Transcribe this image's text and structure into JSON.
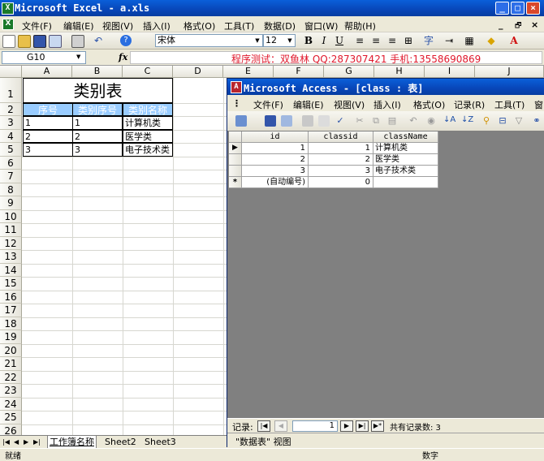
{
  "excel": {
    "title": "Microsoft Excel - a.xls",
    "menu": [
      "文件(F)",
      "编辑(E)",
      "视图(V)",
      "插入(I)",
      "格式(O)",
      "工具(T)",
      "数据(D)",
      "窗口(W)",
      "帮助(H)"
    ],
    "font_name": "宋体",
    "font_size": "12",
    "name_box": "G10",
    "fx": "fx",
    "banner": "程序测试：双鱼林 QQ:287307421 手机:13558690869",
    "columns": [
      "A",
      "B",
      "C",
      "D",
      "E",
      "F",
      "G",
      "H",
      "I",
      "J"
    ],
    "rows": [
      "1",
      "2",
      "3",
      "4",
      "5",
      "6",
      "7",
      "8",
      "9",
      "10",
      "11",
      "12",
      "13",
      "14",
      "15",
      "16",
      "17",
      "18",
      "19",
      "20",
      "21",
      "22",
      "23",
      "24",
      "25",
      "26"
    ],
    "table_title": "类别表",
    "headers": [
      "序号",
      "类别序号",
      "类别名称"
    ],
    "data_rows": [
      [
        "1",
        "1",
        "计算机类"
      ],
      [
        "2",
        "2",
        "医学类"
      ],
      [
        "3",
        "3",
        "电子技术类"
      ]
    ],
    "sheet_tabs": [
      "工作簿名称",
      "Sheet2",
      "Sheet3"
    ],
    "status_left": "就绪",
    "status_right": "数字",
    "header_color": "#99ccff"
  },
  "access": {
    "title": "Microsoft Access - [class : 表]",
    "menu": [
      "文件(F)",
      "编辑(E)",
      "视图(V)",
      "插入(I)",
      "格式(O)",
      "记录(R)",
      "工具(T)",
      "窗"
    ],
    "columns": [
      "id",
      "classid",
      "className"
    ],
    "rows": [
      [
        "1",
        "1",
        "计算机类"
      ],
      [
        "2",
        "2",
        "医学类"
      ],
      [
        "3",
        "3",
        "电子技术类"
      ]
    ],
    "new_row": [
      "(自动编号)",
      "0",
      ""
    ],
    "nav_label": "记录:",
    "current_record": "1",
    "record_count": "共有记录数: 3",
    "status": "\"数据表\" 视图"
  }
}
